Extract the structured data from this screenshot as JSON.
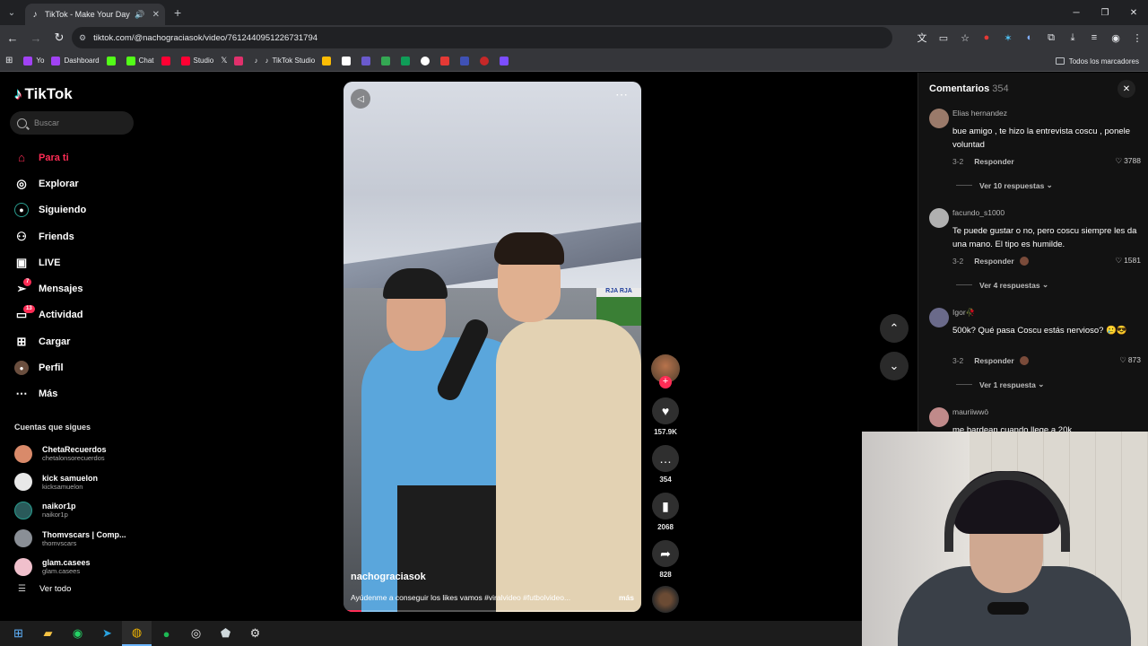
{
  "browser": {
    "tab_title": "TikTok - Make Your Day",
    "url": "tiktok.com/@nachograciasok/video/7612440951226731794",
    "bookmarks": [
      {
        "label": "Yo",
        "color": "#a142f4"
      },
      {
        "label": "Dashboard",
        "color": "#a142f4"
      },
      {
        "label": "",
        "color": "#53fc18"
      },
      {
        "label": "Chat",
        "color": "#53fc18"
      },
      {
        "label": "",
        "color": "#ff0033"
      },
      {
        "label": "Studio",
        "color": "#ff0033"
      },
      {
        "label": "",
        "color": "#ffffff"
      },
      {
        "label": "",
        "color": "#e1306c"
      },
      {
        "label": "",
        "color": "#ffffff"
      },
      {
        "label": "TikTok Studio",
        "color": "#ffffff"
      }
    ],
    "all_bookmarks": "Todos los marcadores"
  },
  "sidebar": {
    "logo": "TikTok",
    "search_placeholder": "Buscar",
    "nav": [
      {
        "label": "Para ti",
        "icon": "home-icon",
        "active": true
      },
      {
        "label": "Explorar",
        "icon": "compass-icon"
      },
      {
        "label": "Siguiendo",
        "icon": "following-icon"
      },
      {
        "label": "Friends",
        "icon": "friends-icon"
      },
      {
        "label": "LIVE",
        "icon": "live-icon"
      },
      {
        "label": "Mensajes",
        "icon": "messages-icon",
        "badge": "7"
      },
      {
        "label": "Actividad",
        "icon": "activity-icon",
        "badge": "13"
      },
      {
        "label": "Cargar",
        "icon": "upload-icon"
      },
      {
        "label": "Perfil",
        "icon": "profile-icon"
      },
      {
        "label": "Más",
        "icon": "more-icon"
      }
    ],
    "following_title": "Cuentas que sigues",
    "following": [
      {
        "name": "ChetaRecuerdos",
        "handle": "chetalonsorecuerdos",
        "color": "#d98a6a"
      },
      {
        "name": "kick samuelon",
        "handle": "kicksamuelon",
        "color": "#e8e8e8"
      },
      {
        "name": "naikor1p",
        "handle": "naikor1p",
        "color": "#2a5a5a"
      },
      {
        "name": "Thomvscars | Comp...",
        "handle": "thomvscars",
        "color": "#8a8f96"
      },
      {
        "name": "glam.casees",
        "handle": "glam.casees",
        "color": "#f0c0cc"
      }
    ],
    "see_all": "Ver todo"
  },
  "video": {
    "username": "nachograciasok",
    "caption": "Ayúdenme a conseguir los likes vamos #viralvideo #futbolvideo...",
    "more": "más",
    "screen_text": "RJA RJA",
    "progress": 0.06
  },
  "actions": {
    "likes": "157.9K",
    "comments": "354",
    "saves": "2068",
    "shares": "828"
  },
  "comments_panel": {
    "title": "Comentarios",
    "count": "354",
    "items": [
      {
        "user": "Elias hernandez",
        "text": "bue amigo , te hizo la entrevista coscu , ponele voluntad",
        "date": "3-2",
        "reply": "Responder",
        "likes": "3788",
        "view": "Ver 10 respuestas",
        "color": "#9a7a6a"
      },
      {
        "user": "facundo_s1000",
        "text": "Te puede gustar o no, pero coscu siempre les da una mano. El tipo es humilde.",
        "date": "3-2",
        "reply": "Responder",
        "likes": "1581",
        "view": "Ver 4 respuestas",
        "color": "#b0b0b0"
      },
      {
        "user": "Igor🥀",
        "text": "500k? Qué pasa Coscu estás nervioso? 🥲😎",
        "date": "3-2",
        "reply": "Responder",
        "likes": "873",
        "view": "Ver 1 respuesta",
        "color": "#6a6a8a"
      },
      {
        "user": "mauriiwwō",
        "text": "me bardean cuando llege a 20k",
        "color": "#c08a8a"
      }
    ]
  }
}
